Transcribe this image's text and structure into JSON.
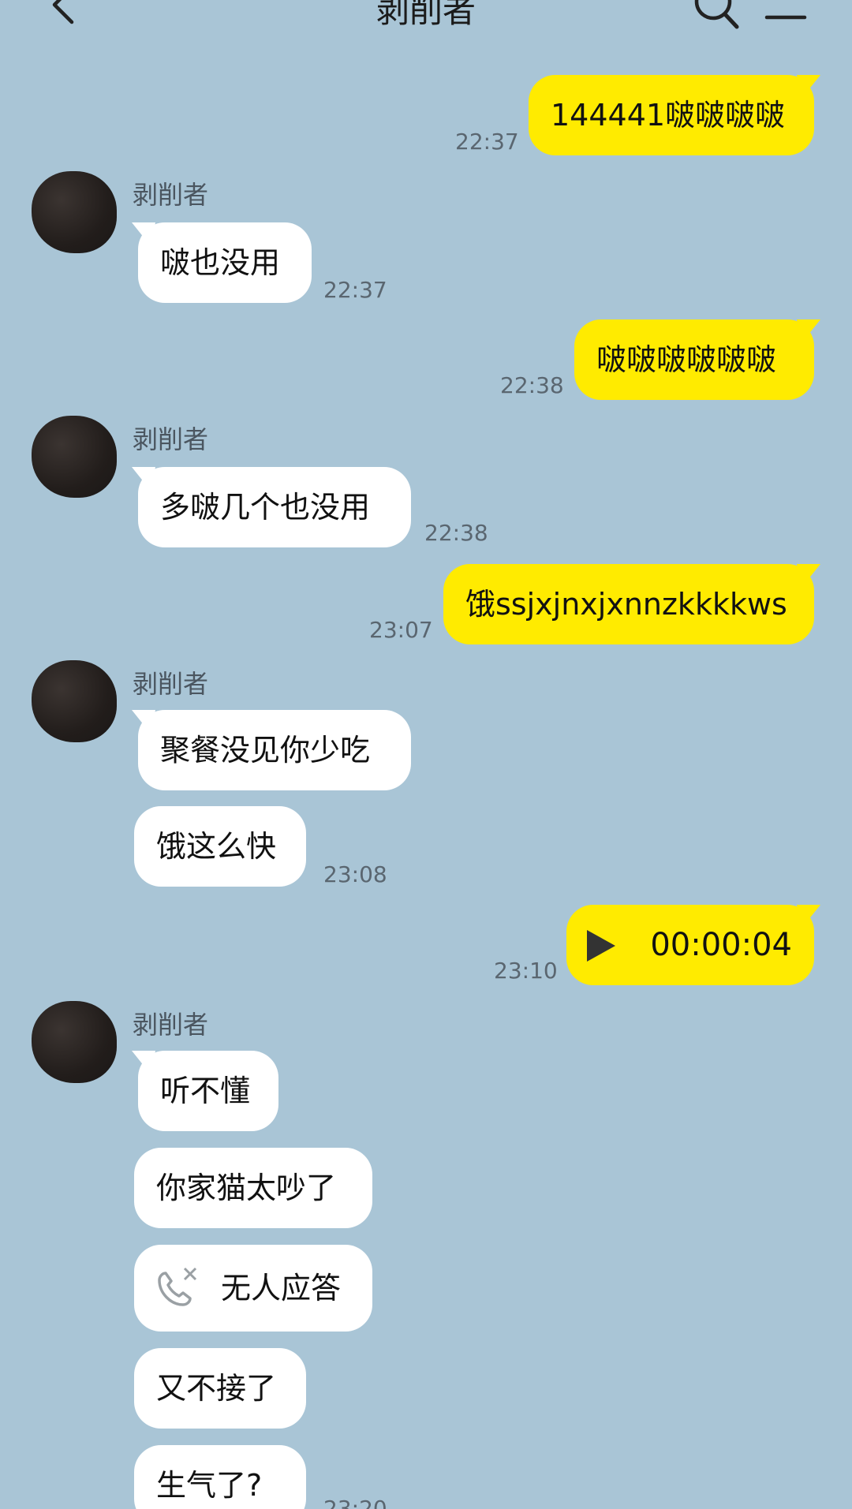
{
  "header": {
    "title": "剥削者"
  },
  "messages": {
    "m1": {
      "text": "144441啵啵啵啵",
      "time": "22:37"
    },
    "s1": {
      "name": "剥削者"
    },
    "m2": {
      "text": "啵也没用",
      "time": "22:37"
    },
    "m3": {
      "text": "啵啵啵啵啵啵",
      "time": "22:38"
    },
    "s2": {
      "name": "剥削者"
    },
    "m4": {
      "text": "多啵几个也没用",
      "time": "22:38"
    },
    "m5": {
      "text": "饿ssjxjnxjxnnzkkkkws",
      "time": "23:07"
    },
    "s3": {
      "name": "剥削者"
    },
    "m6": {
      "text": "聚餐没见你少吃"
    },
    "m7": {
      "text": "饿这么快",
      "time": "23:08"
    },
    "m8": {
      "duration": "00:00:04",
      "time": "23:10",
      "icon": "play-icon"
    },
    "s4": {
      "name": "剥削者"
    },
    "m9": {
      "text": "听不懂"
    },
    "m10": {
      "text": "你家猫太吵了"
    },
    "m11": {
      "text": "无人应答",
      "icon": "missed-call-icon"
    },
    "m12": {
      "text": "又不接了"
    },
    "m13": {
      "text": "生气了?",
      "time": "23:20"
    }
  },
  "colors": {
    "background": "#a9c5d6",
    "outgoing_bubble": "#ffeb00",
    "incoming_bubble": "#ffffff",
    "timestamp": "#5a6670"
  }
}
